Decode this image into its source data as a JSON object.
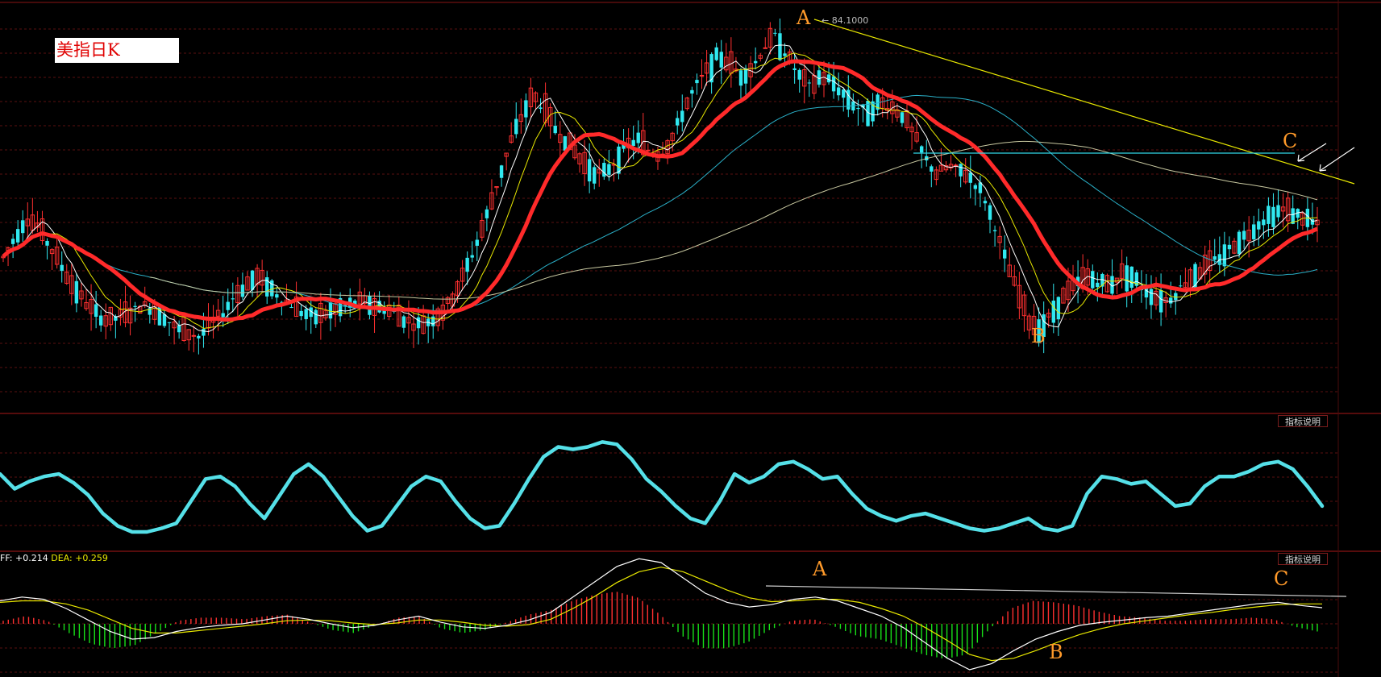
{
  "title": "美指日K",
  "indicator_button_label": "指标说明",
  "macd": {
    "label_prefix": "FF: ",
    "dif_value": "+0.214",
    "dea_label": " DEA: ",
    "dea_value": "+0.259"
  },
  "high_marker": "← 84.1000",
  "annotations": {
    "price_A": "A",
    "price_B": "B",
    "price_C": "C",
    "macd_A": "A",
    "macd_B": "B",
    "macd_C": "C"
  },
  "colors": {
    "background": "#000000",
    "grid": "#5a0f0f",
    "candle_up": "#ff3030",
    "candle_down": "#30e8f0",
    "ma_white": "#ffffff",
    "ma_yellow": "#e8e800",
    "ma_red": "#ff2a2a",
    "ma_cyan": "#2ab0c8",
    "ma_long": "#c8c8a0",
    "oscillator": "#55e0e8",
    "macd_hist_up": "#ff3030",
    "macd_hist_down": "#18e018",
    "annotation": "#ff9a2a"
  },
  "chart_data": [
    {
      "type": "candlestick",
      "title": "美指日K",
      "high_marker_value": 84.1,
      "series_close": [
        78.3,
        78.8,
        79.3,
        79.1,
        78.6,
        78.1,
        77.6,
        77.2,
        76.9,
        76.7,
        76.8,
        76.9,
        77.1,
        77.0,
        76.8,
        76.5,
        76.4,
        76.3,
        76.6,
        76.9,
        77.3,
        77.6,
        77.8,
        77.6,
        77.3,
        77.1,
        76.9,
        76.8,
        76.9,
        77.0,
        77.1,
        77.2,
        77.1,
        77.0,
        76.9,
        76.7,
        76.6,
        76.7,
        76.9,
        77.3,
        77.9,
        78.6,
        79.4,
        80.3,
        81.2,
        81.9,
        82.4,
        82.0,
        81.5,
        81.2,
        80.8,
        80.5,
        80.4,
        80.7,
        81.1,
        81.3,
        81.0,
        80.9,
        81.3,
        82.0,
        82.6,
        83.0,
        83.4,
        83.2,
        82.9,
        83.1,
        83.6,
        83.9,
        83.4,
        82.9,
        82.6,
        82.9,
        82.7,
        82.4,
        82.1,
        82.0,
        82.2,
        82.1,
        81.9,
        81.4,
        80.8,
        80.4,
        80.6,
        80.5,
        80.3,
        79.9,
        79.1,
        78.2,
        77.4,
        76.7,
        76.5,
        76.9,
        77.3,
        77.6,
        77.8,
        77.7,
        77.6,
        77.9,
        77.8,
        77.5,
        77.3,
        77.2,
        77.5,
        77.8,
        78.0,
        78.2,
        78.4,
        78.7,
        78.9,
        79.2,
        79.4,
        79.5,
        79.4,
        79.3,
        79.1
      ]
    },
    {
      "type": "line",
      "name": "oscillator",
      "values": [
        62,
        50,
        56,
        60,
        62,
        55,
        45,
        30,
        20,
        15,
        15,
        18,
        22,
        40,
        58,
        60,
        52,
        38,
        26,
        44,
        62,
        70,
        60,
        44,
        28,
        16,
        20,
        36,
        52,
        60,
        56,
        40,
        26,
        18,
        20,
        38,
        58,
        76,
        84,
        82,
        84,
        88,
        86,
        74,
        58,
        48,
        36,
        26,
        22,
        40,
        62,
        55,
        60,
        70,
        72,
        66,
        58,
        60,
        46,
        34,
        28,
        24,
        28,
        30,
        26,
        22,
        18,
        16,
        18,
        22,
        26,
        18,
        16,
        20,
        46,
        60,
        58,
        54,
        56,
        46,
        36,
        38,
        52,
        60,
        60,
        64,
        70,
        72,
        66,
        52,
        36
      ]
    },
    {
      "type": "line",
      "name": "MACD",
      "dif": 0.214,
      "dea": 0.259,
      "series_dif": [
        0.3,
        0.35,
        0.32,
        0.2,
        0.05,
        -0.1,
        -0.2,
        -0.18,
        -0.1,
        -0.05,
        -0.02,
        0.0,
        0.05,
        0.1,
        0.06,
        0.0,
        -0.05,
        -0.02,
        0.05,
        0.1,
        0.02,
        -0.04,
        -0.06,
        -0.02,
        0.05,
        0.15,
        0.35,
        0.55,
        0.75,
        0.85,
        0.8,
        0.6,
        0.4,
        0.28,
        0.22,
        0.25,
        0.32,
        0.35,
        0.3,
        0.2,
        0.1,
        -0.05,
        -0.25,
        -0.45,
        -0.6,
        -0.52,
        -0.35,
        -0.2,
        -0.1,
        -0.02,
        0.02,
        0.05,
        0.08,
        0.1,
        0.14,
        0.18,
        0.22,
        0.26,
        0.28,
        0.24,
        0.21
      ],
      "series_dea": [
        0.28,
        0.3,
        0.3,
        0.26,
        0.18,
        0.06,
        -0.06,
        -0.12,
        -0.12,
        -0.09,
        -0.06,
        -0.03,
        0.0,
        0.04,
        0.05,
        0.04,
        0.01,
        -0.01,
        0.01,
        0.05,
        0.05,
        0.02,
        -0.02,
        -0.03,
        -0.01,
        0.06,
        0.2,
        0.36,
        0.54,
        0.68,
        0.74,
        0.68,
        0.56,
        0.44,
        0.34,
        0.29,
        0.3,
        0.32,
        0.32,
        0.28,
        0.2,
        0.1,
        -0.05,
        -0.22,
        -0.4,
        -0.48,
        -0.45,
        -0.35,
        -0.24,
        -0.14,
        -0.06,
        0.0,
        0.04,
        0.08,
        0.12,
        0.15,
        0.19,
        0.22,
        0.25,
        0.26,
        0.26
      ]
    }
  ]
}
